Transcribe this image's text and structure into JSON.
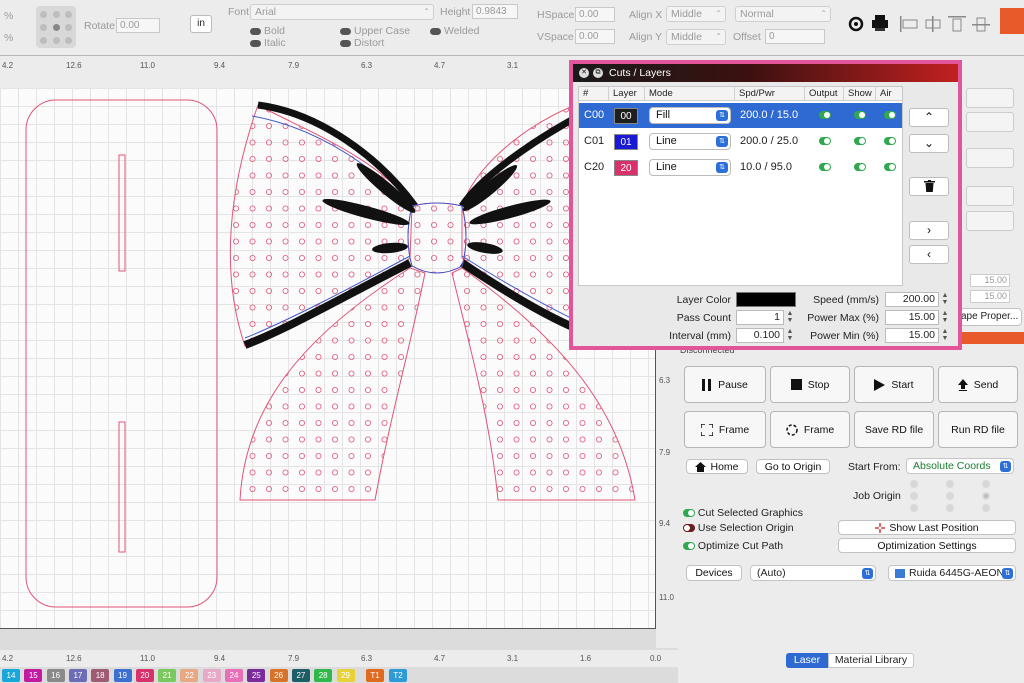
{
  "toolbar": {
    "pct1": "%",
    "pct2": "%",
    "rotate_label": "Rotate",
    "rotate_value": "0.00",
    "unit_button": "in",
    "font_label": "Font",
    "font_value": "Arial",
    "height_label": "Height",
    "height_value": "0.9843",
    "hspace_label": "HSpace",
    "hspace_value": "0.00",
    "vspace_label": "VSpace",
    "vspace_value": "0.00",
    "align_x_label": "Align X",
    "align_x_value": "Middle",
    "align_y_label": "Align Y",
    "align_y_value": "Middle",
    "style_value": "Normal",
    "offset_label": "Offset",
    "offset_value": "0",
    "bold": "Bold",
    "italic": "Italic",
    "upper_case": "Upper Case",
    "distort": "Distort",
    "welded": "Welded"
  },
  "ruler_top": [
    "4.2",
    "12.6",
    "11.0",
    "9.4",
    "7.9",
    "6.3",
    "4.7",
    "3.1"
  ],
  "ruler_bottom": [
    "4.2",
    "12.6",
    "11.0",
    "9.4",
    "7.9",
    "6.3",
    "4.7",
    "3.1",
    "1.6",
    "0.0"
  ],
  "ruler_right": [
    "6.3",
    "7.9",
    "9.4",
    "11.0"
  ],
  "palette": [
    {
      "label": "14",
      "color": "#19a6d8"
    },
    {
      "label": "15",
      "color": "#c21b9f"
    },
    {
      "label": "16",
      "color": "#8a8a8a"
    },
    {
      "label": "17",
      "color": "#6d6db7"
    },
    {
      "label": "18",
      "color": "#a05a74"
    },
    {
      "label": "19",
      "color": "#3c6fd0"
    },
    {
      "label": "20",
      "color": "#d9316b"
    },
    {
      "label": "21",
      "color": "#7bc95e"
    },
    {
      "label": "22",
      "color": "#e8a883"
    },
    {
      "label": "23",
      "color": "#e8a8c8"
    },
    {
      "label": "24",
      "color": "#e86fb8"
    },
    {
      "label": "25",
      "color": "#7a2a9a"
    },
    {
      "label": "26",
      "color": "#d7742a"
    },
    {
      "label": "27",
      "color": "#1d5e66"
    },
    {
      "label": "28",
      "color": "#31b84c"
    },
    {
      "label": "29",
      "color": "#e8d23a"
    },
    {
      "label": "T1",
      "color": "#e06a1f"
    },
    {
      "label": "T2",
      "color": "#2f9ad8"
    }
  ],
  "cuts_dialog": {
    "title": "Cuts / Layers",
    "headers": [
      "#",
      "Layer",
      "Mode",
      "Spd/Pwr",
      "Output",
      "Show",
      "Air"
    ],
    "rows": [
      {
        "id": "C00",
        "layer": "00",
        "layer_color": "#1e1e1e",
        "mode": "Fill",
        "spd_pwr": "200.0 / 15.0",
        "output": true,
        "show": true,
        "air": true
      },
      {
        "id": "C01",
        "layer": "01",
        "layer_color": "#1a1ad6",
        "mode": "Line",
        "spd_pwr": "200.0 / 25.0",
        "output": true,
        "show": true,
        "air": true
      },
      {
        "id": "C20",
        "layer": "20",
        "layer_color": "#d9316b",
        "mode": "Line",
        "spd_pwr": "10.0 / 95.0",
        "output": true,
        "show": true,
        "air": true
      }
    ],
    "side_buttons": {
      "up": "⌃",
      "down": "⌄",
      "delete": "🗑",
      "right": "›",
      "left": "‹"
    },
    "layer_color_label": "Layer Color",
    "pass_count_label": "Pass Count",
    "pass_count_value": "1",
    "interval_label": "Interval (mm)",
    "interval_value": "0.100",
    "speed_label": "Speed (mm/s)",
    "speed_value": "200.00",
    "power_max_label": "Power Max (%)",
    "power_max_value": "15.00",
    "power_min_label": "Power Min (%)",
    "power_min_value": "15.00"
  },
  "side_partial": {
    "shape_props": "ape Proper...",
    "status": "Disconnected",
    "val1": "15.00",
    "val2": "15.00"
  },
  "laser": {
    "pause": "Pause",
    "stop": "Stop",
    "start": "Start",
    "send": "Send",
    "frame1": "Frame",
    "frame2": "Frame",
    "save_rd": "Save RD file",
    "run_rd": "Run RD file",
    "home": "Home",
    "go_to_origin": "Go to Origin",
    "start_from_label": "Start From:",
    "start_from_value": "Absolute Coords",
    "job_origin_label": "Job Origin",
    "cut_selected": "Cut Selected Graphics",
    "use_selection_origin": "Use Selection Origin",
    "optimize_cut_path": "Optimize Cut Path",
    "show_last_position": "Show Last Position",
    "optimization_settings": "Optimization Settings",
    "devices": "Devices",
    "auto": "(Auto)",
    "device_name": "Ruida 6445G-AEON",
    "tab_laser": "Laser",
    "tab_material": "Material Library"
  }
}
